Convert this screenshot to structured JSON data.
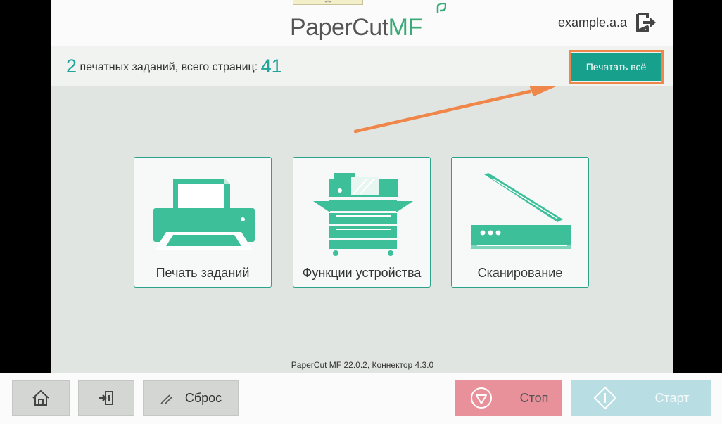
{
  "header": {
    "logo_main": "PaperCut",
    "logo_accent": "MF",
    "top_notch": "«•»",
    "username": "example.a.a"
  },
  "summary": {
    "job_count": "2",
    "job_text": "печатных заданий, всего страниц:",
    "page_count": "41",
    "print_all_label": "Печатать всё"
  },
  "tiles": [
    {
      "label": "Печать заданий",
      "icon": "printer-icon"
    },
    {
      "label": "Функции устройства",
      "icon": "copier-icon"
    },
    {
      "label": "Сканирование",
      "icon": "scanner-icon"
    }
  ],
  "footer": {
    "version": "PaperCut MF 22.0.2, Коннектор 4.3.0"
  },
  "bottom": {
    "reset_label": "Сброс",
    "stop_label": "Стоп",
    "start_label": "Старт"
  },
  "colors": {
    "accent": "#17a08c",
    "icon_green": "#3dbf9a",
    "highlight": "#f0874a",
    "stop": "#e9919b",
    "start": "#b8dde2"
  }
}
